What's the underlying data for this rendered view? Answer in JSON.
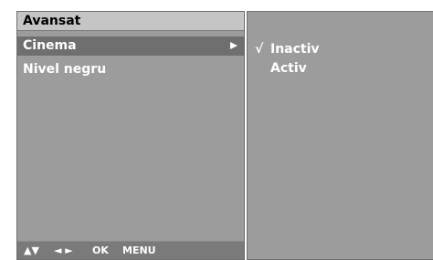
{
  "left_panel": {
    "title": "Avansat",
    "items": [
      {
        "label": "Cinema",
        "selected": true
      },
      {
        "label": "Nivel negru",
        "selected": false
      }
    ],
    "hint_bar": {
      "updown": "▲▼",
      "leftright": "◄ ►",
      "ok": "OK",
      "menu": "MENU"
    }
  },
  "right_panel": {
    "check": "√",
    "options": [
      {
        "label": "Inactiv",
        "checked": true
      },
      {
        "label": "Activ",
        "checked": false
      }
    ]
  },
  "colors": {
    "panel_bg": "#9c9c9c",
    "title_bg": "#c5c5c5",
    "selected_bg": "#6f6f6f",
    "text": "#ffffff"
  }
}
